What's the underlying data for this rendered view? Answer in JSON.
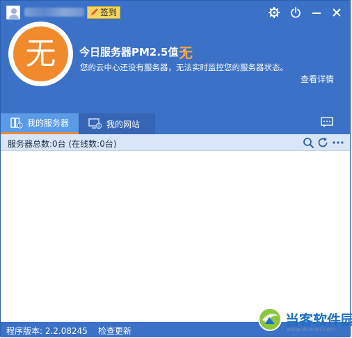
{
  "header": {
    "signin_label": "签到",
    "pm_title": "今日服务器PM2.5值 :",
    "pm_value": "无",
    "avatar_char": "无",
    "description": "您的云中心还没有服务器，无法实时监控您的服务器状态。",
    "detail_link": "查看详情"
  },
  "tabs": [
    {
      "label": "我的服务器",
      "icon": "server-icon",
      "active": true
    },
    {
      "label": "我的网站",
      "icon": "website-icon",
      "active": false
    }
  ],
  "statusbar": {
    "count_text": "服务器总数:0台 (在线数:0台)"
  },
  "footer": {
    "version_text": "程序版本: 2.2.08245",
    "check_update": "检查更新"
  },
  "watermark": {
    "text": "当客软件园",
    "url": "www.downkr.com"
  },
  "colors": {
    "header_bg": "#3b71c6",
    "accent_orange": "#f08a2c",
    "tab_active_bg": "#5b9ae6",
    "statusbar_bg": "#d9e6f8"
  }
}
